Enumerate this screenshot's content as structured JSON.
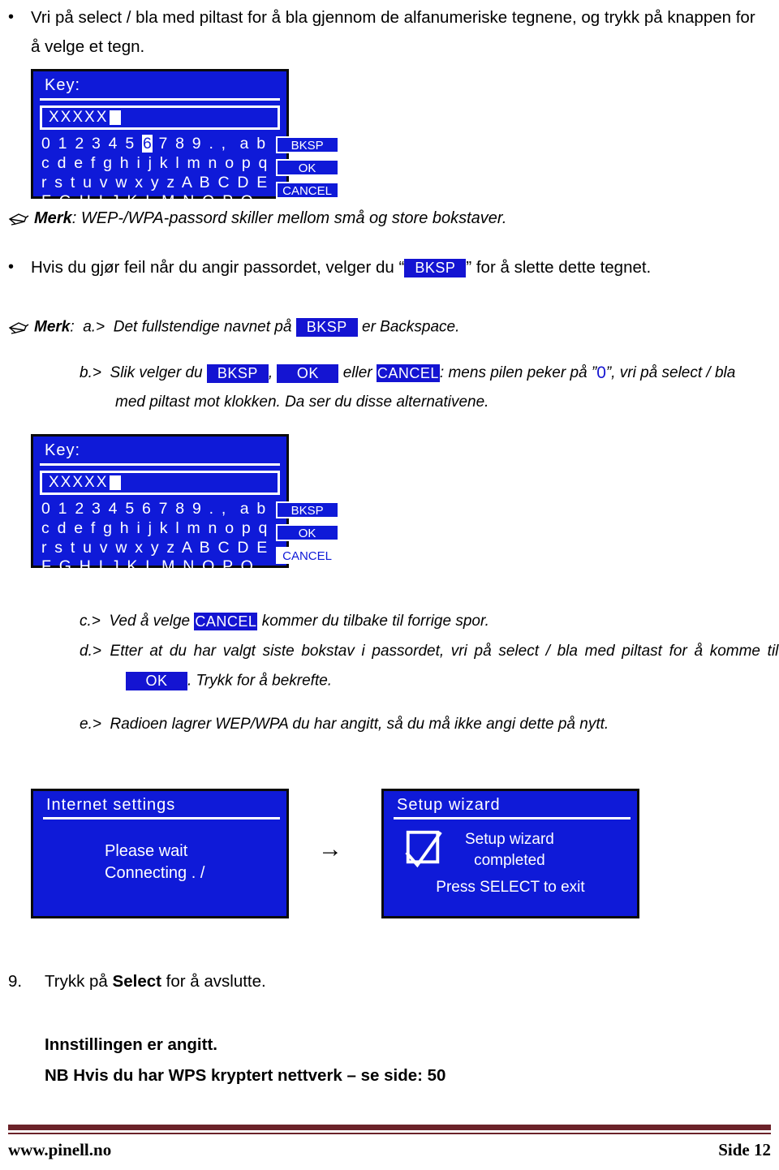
{
  "intro": {
    "bullet": "•",
    "text": "Vri på select / bla med piltast for å bla gjennom de alfanumeriske tegnene, og trykk på knappen for å velge et tegn."
  },
  "screen1": {
    "title": "Key:",
    "input_value": "XXXXX",
    "rows": [
      "0 1 2 3 4 5 6 7 8 9 . ,  a b",
      "c d e f g h i j k l m n o p q",
      "r s t u v w x y z A B C D E",
      "F G H I J K L M N O P Q"
    ],
    "row0_prefix": "0 1 2 3 4 5 ",
    "row0_highlight": "6",
    "row0_suffix": " 7 8 9 . ,  a b",
    "softkeys": [
      {
        "label": "BKSP",
        "selected": false
      },
      {
        "label": "OK",
        "selected": false
      },
      {
        "label": "CANCEL",
        "selected": false
      }
    ]
  },
  "note1": {
    "icon": "note-pointer-icon",
    "label": "Merk",
    "colon": ":",
    "text": " WEP-/WPA-passord skiller mellom små og store bokstaver."
  },
  "bullet2": {
    "bullet": "•",
    "text_before": "Hvis du gjør feil når du angir passordet, velger du  “",
    "badge": "BKSP",
    "text_after": "”  for å slette dette tegnet."
  },
  "note2": {
    "icon": "note-pointer-icon",
    "label": "Merk",
    "colon": ":",
    "items": {
      "a": {
        "marker": "a.>",
        "text_before": "Det fullstendige navnet på",
        "badge": "BKSP",
        "text_after": "er Backspace."
      },
      "b": {
        "marker": "b.>",
        "text_before": "Slik velger du",
        "badge1": "BKSP",
        "comma": ",",
        "badge2": "OK",
        "mid": "eller",
        "badge3": "CANCEL",
        "text_after": ": mens pilen peker på ”",
        "bluechar": "0",
        "text_after2": "”, vri på select / bla",
        "line2": "med piltast mot klokken. Da ser du disse alternativene."
      }
    }
  },
  "screen2": {
    "title": "Key:",
    "input_value": "XXXXX",
    "rows": [
      "0 1 2 3 4 5 6 7 8 9 . ,  a b",
      "c d e f g h i j k l m n o p q",
      "r s t u v w x y z A B C D E",
      "F G H I J K L M N O P Q"
    ],
    "softkeys": [
      {
        "label": "BKSP",
        "selected": false
      },
      {
        "label": "OK",
        "selected": false
      },
      {
        "label": "CANCEL",
        "selected": true
      }
    ]
  },
  "items_cde": {
    "c": {
      "marker": "c.>",
      "text_before": "Ved å velge",
      "badge": "CANCEL",
      "text_after": "kommer du tilbake til forrige spor."
    },
    "d": {
      "marker": "d.>",
      "text": "Etter at du har valgt siste bokstav i passordet, vri på select / bla med piltast for å komme til",
      "badge": "OK",
      "text_after": ". Trykk for å bekrefte."
    },
    "e": {
      "marker": "e.>",
      "text": "Radioen lagrer WEP/WPA du har angitt, så du må ikke angi dette på nytt."
    }
  },
  "screen3": {
    "title": "Internet  settings",
    "line1": "Please  wait",
    "line2": "Connecting . /"
  },
  "arrow": "→",
  "screen4": {
    "title": "Setup  wizard",
    "icon": "checkbox-checked-icon",
    "line1": "Setup  wizard",
    "line2": "completed",
    "line3": "Press  SELECT  to  exit"
  },
  "step9": {
    "number": "9.",
    "text_before": "Trykk på ",
    "bold": "Select",
    "text_after": " for å avslutte."
  },
  "closing": {
    "line1": "Innstillingen er angitt.",
    "line2": "NB Hvis du har WPS kryptert nettverk – se side: 50"
  },
  "footer": {
    "site": "www.pinell.no",
    "page": "Side 12"
  },
  "colors": {
    "lcd_background": "#0f1ad8",
    "badge_blue": "#1414d2",
    "footer_maroon": "#6b2229",
    "text_black": "#000000",
    "lcd_text": "#ffffff"
  }
}
